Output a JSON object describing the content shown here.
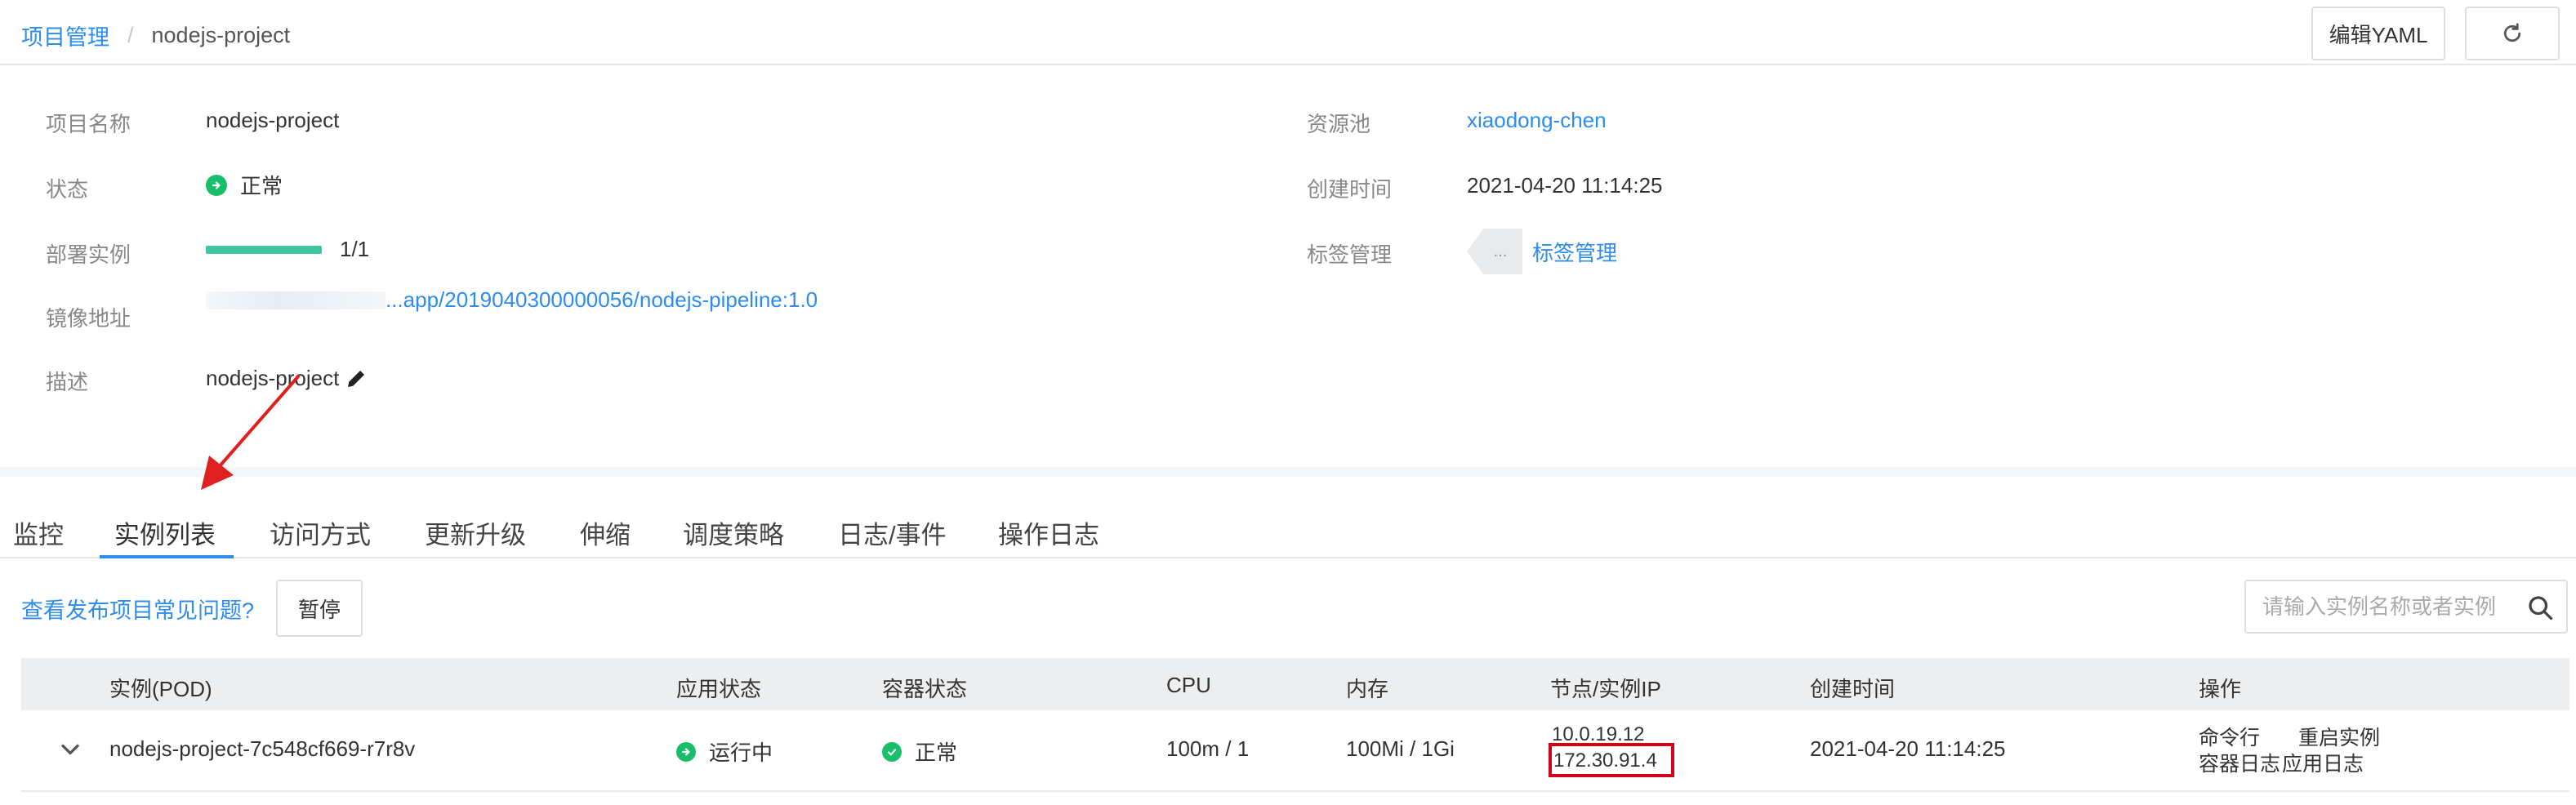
{
  "header": {
    "breadcrumb_root": "项目管理",
    "breadcrumb_sep": "/",
    "breadcrumb_current": "nodejs-project",
    "edit_yaml_label": "编辑YAML"
  },
  "info": {
    "name_label": "项目名称",
    "name_value": "nodejs-project",
    "status_label": "状态",
    "status_value": "正常",
    "instances_label": "部署实例",
    "instances_value": "1/1",
    "instances_progress_pct": 100,
    "image_label": "镜像地址",
    "image_value": "...app/2019040300000056/nodejs-pipeline:1.0",
    "desc_label": "描述",
    "desc_value": "nodejs-project",
    "pool_label": "资源池",
    "pool_value": "xiaodong-chen",
    "created_label": "创建时间",
    "created_value": "2021-04-20 11:14:25",
    "tags_label": "标签管理",
    "tags_badge": "...",
    "tags_link": "标签管理"
  },
  "tabs": [
    {
      "label": "监控"
    },
    {
      "label": "实例列表"
    },
    {
      "label": "访问方式"
    },
    {
      "label": "更新升级"
    },
    {
      "label": "伸缩"
    },
    {
      "label": "调度策略"
    },
    {
      "label": "日志/事件"
    },
    {
      "label": "操作日志"
    }
  ],
  "active_tab": "实例列表",
  "toolbar": {
    "faq_link": "查看发布项目常见问题?",
    "pause_label": "暂停",
    "search_placeholder": "请输入实例名称或者实例"
  },
  "table": {
    "columns": [
      "实例(POD)",
      "应用状态",
      "容器状态",
      "CPU",
      "内存",
      "节点/实例IP",
      "创建时间",
      "操作"
    ],
    "rows": [
      {
        "pod": "nodejs-project-7c548cf669-r7r8v",
        "app_status": "运行中",
        "container_status": "正常",
        "cpu": "100m / 1",
        "memory": "100Mi / 1Gi",
        "node_ip": "10.0.19.12",
        "instance_ip": "172.30.91.4",
        "created": "2021-04-20 11:14:25",
        "actions": [
          "命令行",
          "重启实例",
          "容器日志",
          "应用日志"
        ]
      }
    ]
  },
  "colors": {
    "link": "#2d8cf0",
    "success": "#19be6b",
    "progress": "#3fc7a1",
    "highlight": "#d0021b"
  }
}
